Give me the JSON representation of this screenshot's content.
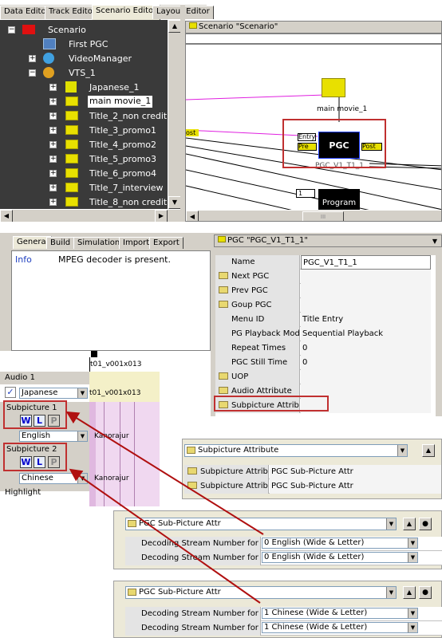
{
  "top_tabs": [
    "Data Editor",
    "Track Editor",
    "Scenario Editor",
    "Layout Editor"
  ],
  "tree": {
    "root": "Scenario",
    "items": [
      {
        "label": "First PGC"
      },
      {
        "label": "VideoManager"
      },
      {
        "label": "VTS_1"
      },
      {
        "label": "Japanese_1"
      },
      {
        "label": "main movie_1"
      },
      {
        "label": "Title_2_non credit"
      },
      {
        "label": "Title_3_promo1"
      },
      {
        "label": "Title_4_promo2"
      },
      {
        "label": "Title_5_promo3"
      },
      {
        "label": "Title_6_promo4"
      },
      {
        "label": "Title_7_interview"
      },
      {
        "label": "Title_8_non credit"
      }
    ]
  },
  "scenario_canvas": {
    "title": "Scenario \"Scenario\"",
    "folder_label": "main movie_1",
    "pgc_label": "PGC",
    "pgc_caption": "PGC_V1_T1_1",
    "entry_label": "Entry",
    "pre_label": "Pre",
    "post_label": "Post",
    "program_label": "Program",
    "program_num": "1",
    "left_tag": "ost",
    "scroll_label": "III"
  },
  "bottom_tabs": [
    "General",
    "Build",
    "Simulation",
    "Import",
    "Export"
  ],
  "info": {
    "label": "Info",
    "message": "MPEG decoder is present."
  },
  "track": {
    "timeline_a": "t01_v001x013",
    "timeline_b": "t01_v001x013",
    "audio_label": "Audio 1",
    "audio_lang": "Japanese",
    "sub1_label": "Subpicture 1",
    "sub1_lang": "English",
    "sub1_text": "Kanorajur",
    "sub2_label": "Subpicture 2",
    "sub2_lang": "Chinese",
    "sub2_text": "Kanorajur",
    "highlight_label": "Highlight",
    "w": "W",
    "l": "L",
    "p": "P"
  },
  "pgc_props": {
    "title": "PGC \"PGC_V1_T1_1\"",
    "rows": [
      {
        "name": "Name",
        "value": "PGC_V1_T1_1"
      },
      {
        "name": "Next PGC",
        "value": ""
      },
      {
        "name": "Prev PGC",
        "value": ""
      },
      {
        "name": "Goup PGC",
        "value": ""
      },
      {
        "name": "Menu ID",
        "value": "Title Entry"
      },
      {
        "name": "PG Playback Mode",
        "value": "Sequential Playback"
      },
      {
        "name": "Repeat Times",
        "value": "0"
      },
      {
        "name": "PGC Still Time",
        "value": "0"
      },
      {
        "name": "UOP",
        "value": ""
      },
      {
        "name": "Audio Attribute",
        "value": ""
      },
      {
        "name": "Subpicture Attribute",
        "value": ""
      }
    ]
  },
  "subpic_attr": {
    "title": "Subpicture Attribute",
    "rows": [
      {
        "name": "Subpicture Attribute",
        "value": "PGC Sub-Picture Attr"
      },
      {
        "name": "Subpicture Attribute",
        "value": "PGC Sub-Picture Attr"
      }
    ]
  },
  "pgc_sub_1": {
    "title": "PGC Sub-Picture Attr",
    "rows": [
      {
        "name": "Decoding Stream Number for Wide",
        "value": "0  English   (Wide & Letter)"
      },
      {
        "name": "Decoding Stream Number for Letter",
        "value": "0  English   (Wide & Letter)"
      }
    ]
  },
  "pgc_sub_2": {
    "title": "PGC Sub-Picture Attr",
    "rows": [
      {
        "name": "Decoding Stream Number for Wide",
        "value": "1  Chinese   (Wide & Letter)"
      },
      {
        "name": "Decoding Stream Number for Letter",
        "value": "1  Chinese   (Wide & Letter)"
      }
    ]
  },
  "colors": {
    "highlight_red": "#c03030",
    "arrow_red": "#b01010",
    "folder_yellow": "#e8e000",
    "tree_bg": "#3a3a3a",
    "pgc_box": "#000000"
  }
}
